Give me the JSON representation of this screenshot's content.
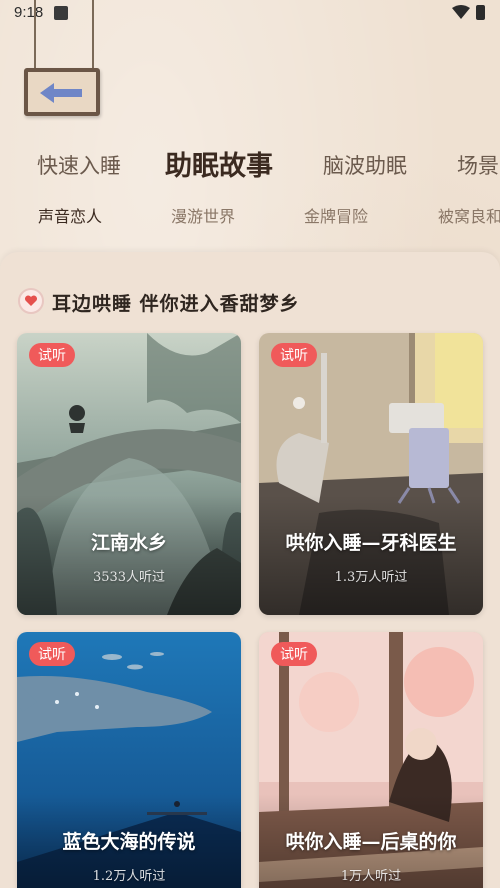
{
  "status_bar": {
    "time": "9:18"
  },
  "nav": {
    "back_icon": "arrow-left-icon"
  },
  "category_tabs": [
    {
      "label": "快速入睡",
      "active": false
    },
    {
      "label": "助眠故事",
      "active": true
    },
    {
      "label": "脑波助眠",
      "active": false
    },
    {
      "label": "场景",
      "active": false
    }
  ],
  "sub_tabs": [
    {
      "label": "声音恋人",
      "active": true
    },
    {
      "label": "漫游世界",
      "active": false
    },
    {
      "label": "金牌冒险",
      "active": false
    },
    {
      "label": "被窝良和",
      "active": false
    }
  ],
  "section": {
    "title": "耳边哄睡   伴你进入香甜梦乡",
    "icon": "heart-icon"
  },
  "cards": [
    {
      "badge": "试听",
      "title": "江南水乡",
      "listeners": "3533人听过"
    },
    {
      "badge": "试听",
      "title": "哄你入睡—牙科医生",
      "listeners": "1.3万人听过"
    },
    {
      "badge": "试听",
      "title": "蓝色大海的传说",
      "listeners": "1.2万人听过"
    },
    {
      "badge": "试听",
      "title": "哄你入睡—后桌的你",
      "listeners": "1万人听过"
    }
  ],
  "colors": {
    "accent": "#f05a5a",
    "highlight": "#f3b48c",
    "text": "#3b2a20"
  }
}
